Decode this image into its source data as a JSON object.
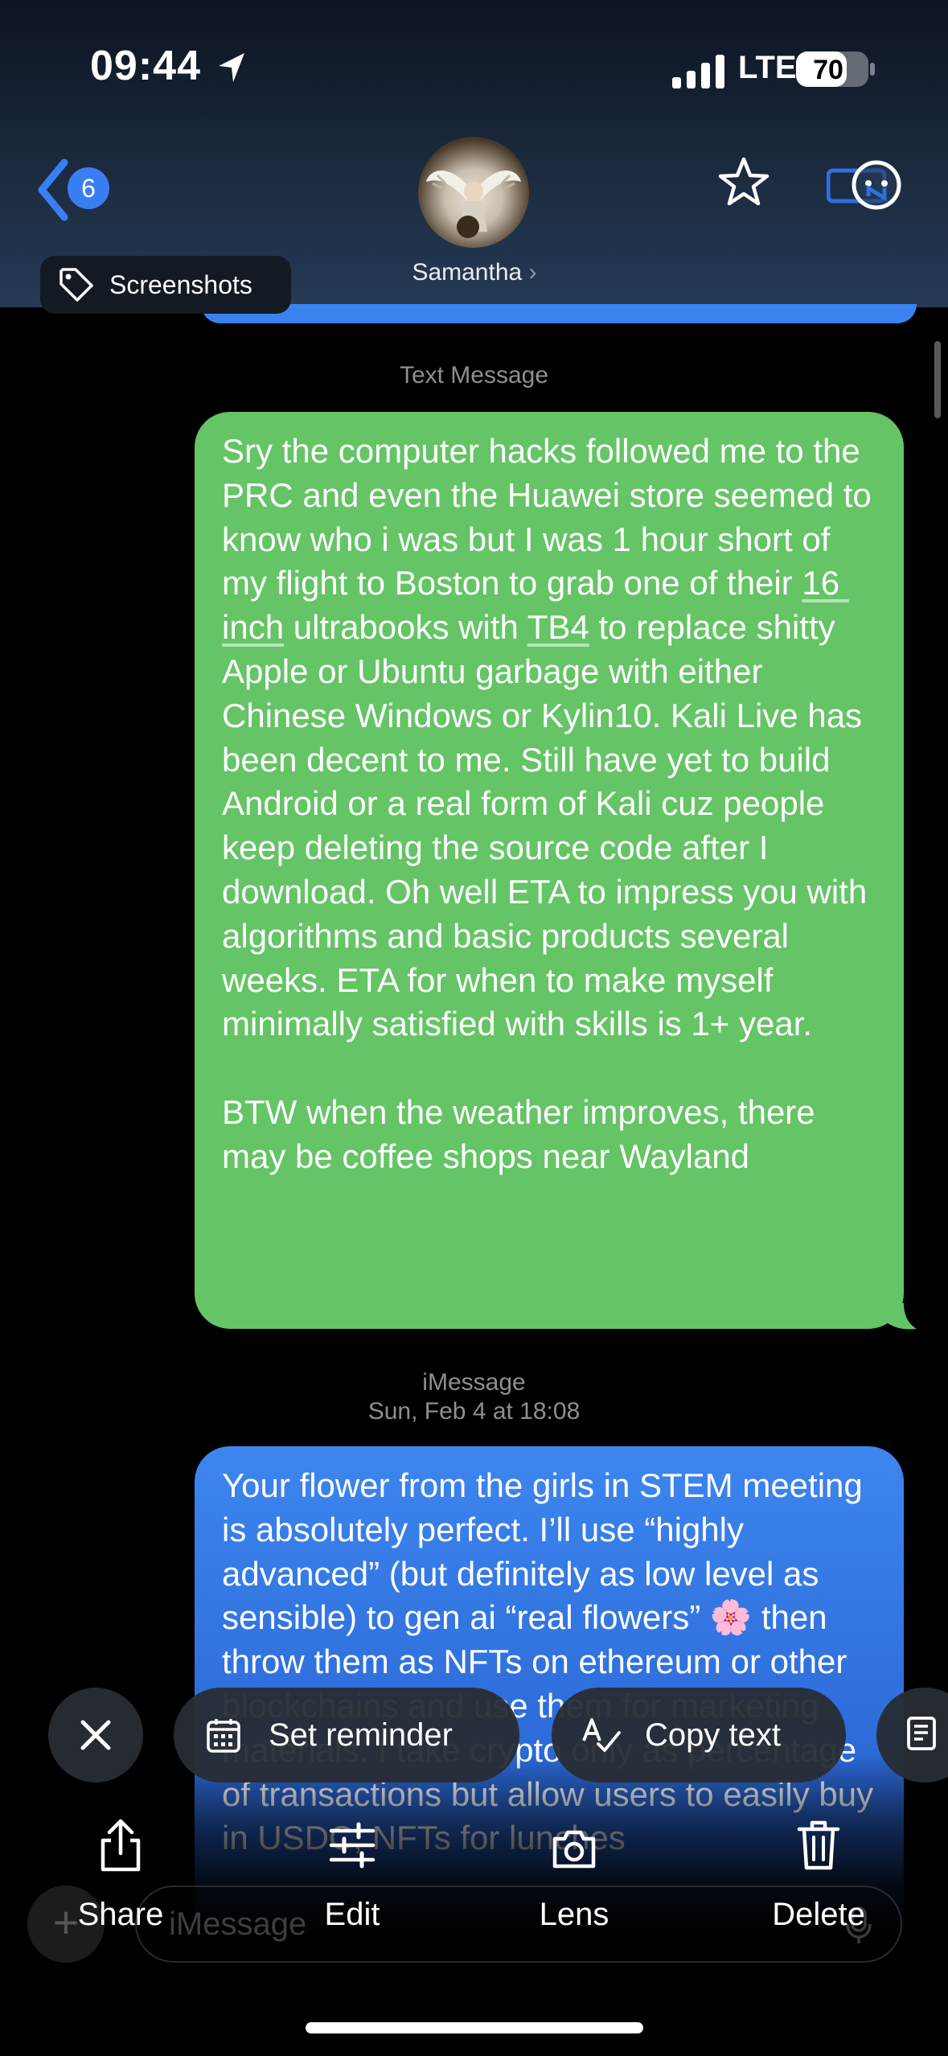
{
  "status_bar": {
    "time": "09:44",
    "network": "LTE",
    "battery": "70",
    "battery_level": 0.7
  },
  "header": {
    "back_count": "6",
    "contact_name": "Samantha",
    "contact_chevron": "›",
    "icons": [
      "chevron-left-icon",
      "star-icon",
      "n-app-icon"
    ]
  },
  "album_tag": {
    "label": "Screenshots",
    "icon": "tag-icon"
  },
  "conversation": {
    "green_label": "Text Message",
    "green_message": {
      "part1": "Sry the computer hacks followed me to the PRC and even the Huawei store seemed to know who i was but I was 1 hour short of my flight to Boston to grab one of their ",
      "link1": "16 inch",
      "part2": " ultrabooks with ",
      "link2": "TB4",
      "part3": " to replace shitty Apple or Ubuntu garbage with either Chinese Windows or Kylin10. Kali Live has been decent to me. Still have yet to build Android or a real form of Kali cuz people keep deleting the source code after I download. Oh well ETA to impress you with algorithms and basic products several weeks. ETA for when to make myself minimally satisfied with skills is 1+ year.\n\nBTW when the weather improves, there may be coffee shops near Wayland"
    },
    "blue_label": "iMessage",
    "blue_timestamp": "Sun, Feb 4 at 18:08",
    "blue_message": "Your flower from the girls in STEM meeting is absolutely perfect. I’ll use “highly advanced” (but definitely as low level as sensible) to gen ai “real flowers” 🌸 then throw them as NFTs on ethereum or other blockchains and use them for marketing materials. I take crypto only as percentage of transactions but allow users to easily buy in USDC, NFTs for lunches"
  },
  "chips": {
    "set_reminder": "Set reminder",
    "copy_text": "Copy text"
  },
  "compose": {
    "placeholder": "iMessage"
  },
  "actions": {
    "share": "Share",
    "edit": "Edit",
    "lens": "Lens",
    "delete": "Delete"
  },
  "colors": {
    "sent_sms": "#65c466",
    "sent_imessage": "#3d86ef",
    "badge": "#3a7ef3"
  }
}
